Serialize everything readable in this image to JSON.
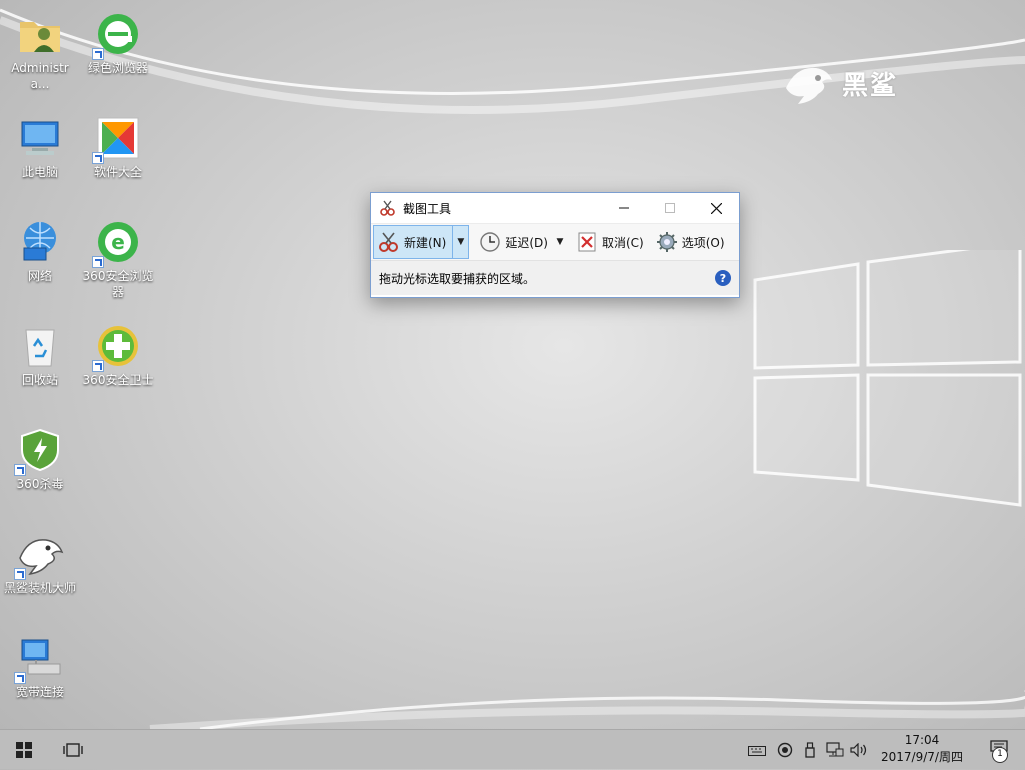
{
  "desktop": {
    "icons": [
      {
        "label": "Administra...",
        "icon": "user-folder-icon"
      },
      {
        "label": "绿色浏览器",
        "icon": "green-browser-icon"
      },
      {
        "label": "此电脑",
        "icon": "computer-icon"
      },
      {
        "label": "软件大全",
        "icon": "software-store-icon"
      },
      {
        "label": "网络",
        "icon": "network-icon"
      },
      {
        "label": "360安全浏览器",
        "icon": "360-browser-icon"
      },
      {
        "label": "回收站",
        "icon": "recycle-bin-icon"
      },
      {
        "label": "360安全卫士",
        "icon": "360-security-icon"
      },
      {
        "label": "360杀毒",
        "icon": "360-antivirus-icon"
      },
      {
        "label": "黑鲨装机大师",
        "icon": "black-shark-icon"
      },
      {
        "label": "宽带连接",
        "icon": "broadband-icon"
      }
    ],
    "brand_text": "黑鲨"
  },
  "snip": {
    "title": "截图工具",
    "new_label": "新建(N)",
    "delay_label": "延迟(D)",
    "cancel_label": "取消(C)",
    "options_label": "选项(O)",
    "status": "拖动光标选取要捕获的区域。",
    "help": "?"
  },
  "taskbar": {
    "time": "17:04",
    "date": "2017/9/7/周四",
    "notification_count": "1"
  },
  "colors": {
    "accent": "#2a5fbf",
    "selected": "#cde6f7",
    "taskbar": "#bdbdbd"
  }
}
